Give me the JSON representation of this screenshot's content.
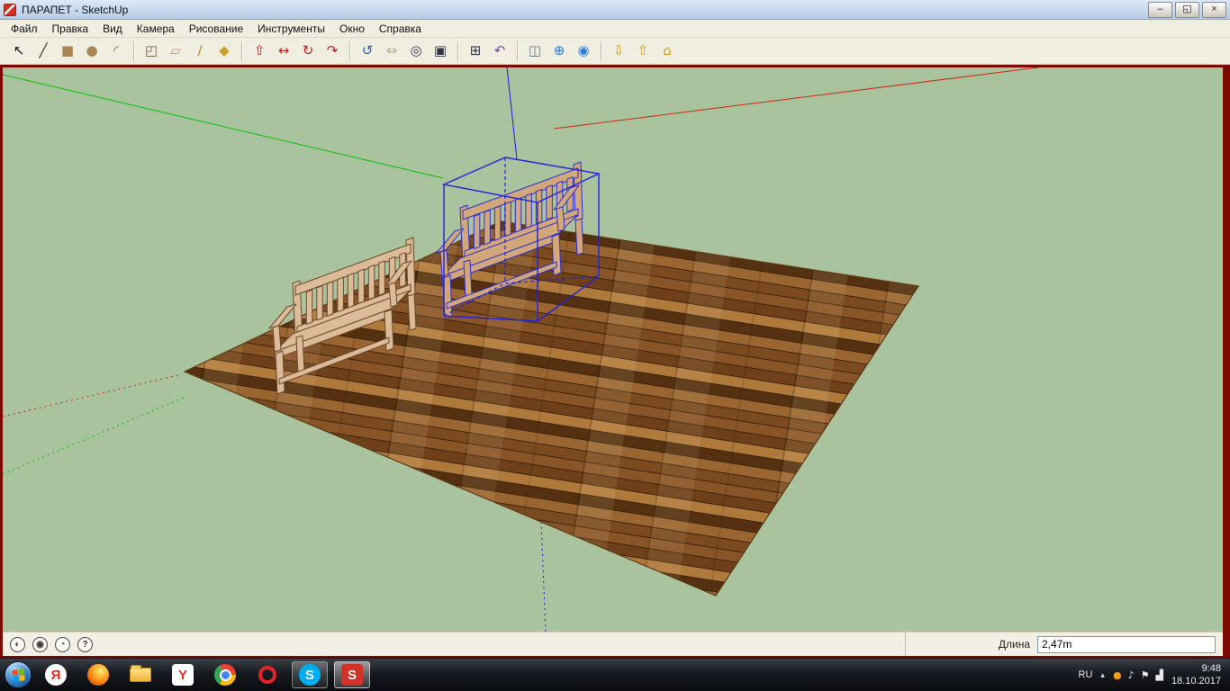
{
  "window": {
    "title": "ПАРАПЕТ - SketchUp",
    "controls": {
      "minimize": "–",
      "restore": "◱",
      "close": "×"
    }
  },
  "menu": {
    "items": [
      "Файл",
      "Правка",
      "Вид",
      "Камера",
      "Рисование",
      "Инструменты",
      "Окно",
      "Справка"
    ]
  },
  "toolbar": {
    "groups": [
      {
        "tools": [
          {
            "name": "select",
            "glyph": "↖",
            "color": "#111111"
          },
          {
            "name": "line",
            "glyph": "╱",
            "color": "#333333"
          },
          {
            "name": "rectangle",
            "glyph": "■",
            "color": "#a98553"
          },
          {
            "name": "circle",
            "glyph": "●",
            "color": "#a98553"
          },
          {
            "name": "arc",
            "glyph": "◜",
            "color": "#8b6b43"
          }
        ]
      },
      {
        "tools": [
          {
            "name": "make-component",
            "glyph": "◰",
            "color": "#6f5b3e"
          },
          {
            "name": "eraser",
            "glyph": "▱",
            "color": "#d9849f"
          },
          {
            "name": "tape-measure",
            "glyph": "∕",
            "color": "#b3891d"
          },
          {
            "name": "paint-bucket",
            "glyph": "◆",
            "color": "#c9a227"
          }
        ]
      },
      {
        "tools": [
          {
            "name": "push-pull",
            "glyph": "⇧",
            "color": "#c22222"
          },
          {
            "name": "move",
            "glyph": "↔",
            "color": "#c22222"
          },
          {
            "name": "rotate",
            "glyph": "↻",
            "color": "#c22222"
          },
          {
            "name": "offset",
            "glyph": "↷",
            "color": "#c22222"
          }
        ]
      },
      {
        "tools": [
          {
            "name": "orbit",
            "glyph": "↺",
            "color": "#1f5fc0"
          },
          {
            "name": "pan",
            "glyph": "⇔",
            "color": "#c6a67e"
          },
          {
            "name": "zoom",
            "glyph": "◎",
            "color": "#333344"
          },
          {
            "name": "zoom-window",
            "glyph": "▣",
            "color": "#333344"
          }
        ]
      },
      {
        "tools": [
          {
            "name": "zoom-extents",
            "glyph": "⊞",
            "color": "#333344"
          },
          {
            "name": "previous-view",
            "glyph": "↶",
            "color": "#7a4fa0"
          }
        ]
      },
      {
        "tools": [
          {
            "name": "section-plane",
            "glyph": "◫",
            "color": "#667788"
          },
          {
            "name": "add-location",
            "glyph": "⊕",
            "color": "#2b7de0"
          },
          {
            "name": "google-earth",
            "glyph": "◉",
            "color": "#2b7de0"
          }
        ]
      },
      {
        "tools": [
          {
            "name": "get-models",
            "glyph": "⇩",
            "color": "#c99a1f"
          },
          {
            "name": "share-model",
            "glyph": "⇧",
            "color": "#c99a1f"
          },
          {
            "name": "3d-warehouse",
            "glyph": "⌂",
            "color": "#c99a1f"
          }
        ]
      }
    ]
  },
  "viewport": {
    "colors": {
      "background": "#a8c39e",
      "deck_brown": "#7b4a1f",
      "bench_wood_light": "#dcbc98",
      "bench_wood_dark": "#d2a77a",
      "selection_blue": "#2222dd",
      "axis_red": "#d02818",
      "axis_green": "#0bbf0b",
      "axis_blue": "#1a1ae6"
    }
  },
  "statusbar": {
    "icons": [
      {
        "name": "geolocation-icon",
        "glyph": "◐"
      },
      {
        "name": "credits-icon",
        "glyph": "◉"
      },
      {
        "name": "instructor-icon",
        "glyph": "◔"
      },
      {
        "name": "help-icon",
        "glyph": "?"
      }
    ],
    "vcb_label": "Длина",
    "vcb_value": "2,47m"
  },
  "taskbar": {
    "start": {
      "colors": [
        "#f25022",
        "#7fba00",
        "#00a4ef",
        "#ffb900"
      ]
    },
    "apps": [
      {
        "name": "yandex-browser",
        "label": "Я",
        "bg": "#ffffff",
        "fg": "#e52e22",
        "shape": "circle"
      },
      {
        "name": "firefox",
        "label": "",
        "css": "firefox",
        "shape": "circle"
      },
      {
        "name": "explorer",
        "label": "",
        "css": "folder"
      },
      {
        "name": "yandex-search",
        "label": "Y",
        "bg": "#ffffff",
        "fg": "#e52e22",
        "shape": "square"
      },
      {
        "name": "chrome",
        "label": "",
        "css": "chrome",
        "shape": "circle"
      },
      {
        "name": "opera",
        "label": "",
        "css": "opera",
        "shape": "circle"
      },
      {
        "name": "skype",
        "label": "S",
        "bg": "#00aff0",
        "fg": "#ffffff",
        "shape": "circle",
        "open": true
      },
      {
        "name": "sketchup",
        "label": "S",
        "bg": "#d33027",
        "fg": "#ffffff",
        "shape": "square",
        "open": true,
        "active": true
      }
    ],
    "tray": {
      "language": "RU",
      "hidden_icons_glyph": "▴",
      "icons": [
        {
          "name": "updater-icon",
          "glyph": "●",
          "color": "#f59a1a"
        },
        {
          "name": "volume-icon",
          "glyph": "♪",
          "color": "#e8e8e8"
        },
        {
          "name": "action-center-icon",
          "glyph": "⚑",
          "color": "#e8e8e8"
        },
        {
          "name": "network-icon",
          "glyph": "▟",
          "color": "#e8e8e8"
        }
      ],
      "time": "9:48",
      "date": "18.10.2017"
    }
  }
}
